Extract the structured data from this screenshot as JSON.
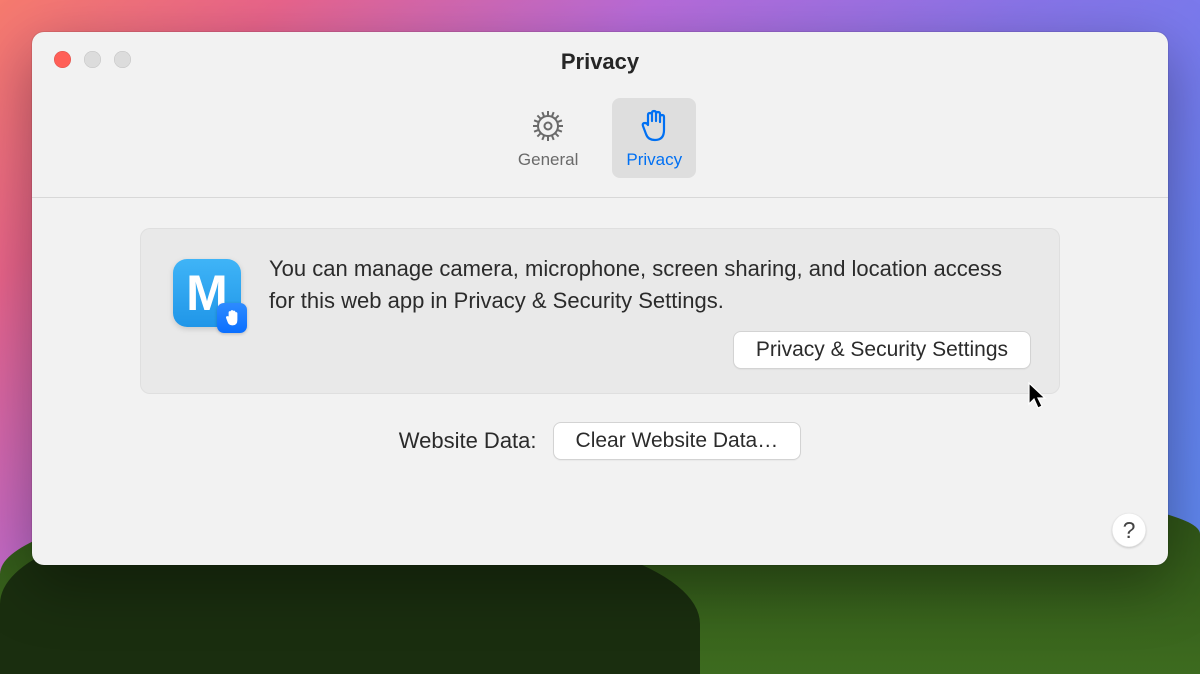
{
  "window": {
    "title": "Privacy"
  },
  "tabs": {
    "general": {
      "label": "General"
    },
    "privacy": {
      "label": "Privacy"
    }
  },
  "info": {
    "app_letter": "M",
    "text": "You can manage camera, microphone, screen sharing, and location access for this web app in Privacy & Security Settings.",
    "button_label": "Privacy & Security Settings"
  },
  "website_data": {
    "label": "Website Data:",
    "button_label": "Clear Website Data…"
  },
  "help": {
    "label": "?"
  }
}
